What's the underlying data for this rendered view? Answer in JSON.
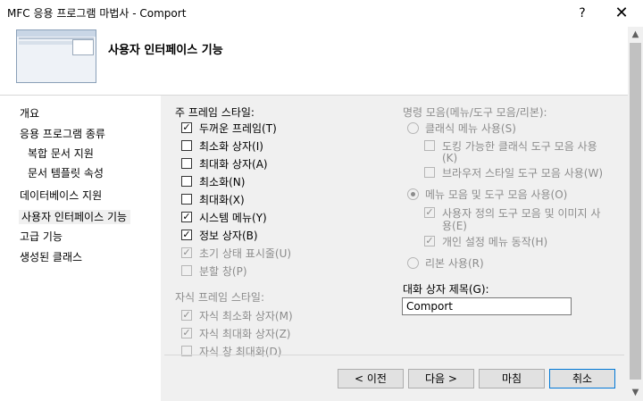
{
  "window": {
    "title": "MFC 응용 프로그램 마법사 - Comport",
    "help_glyph": "?",
    "close_glyph": "✕"
  },
  "header": {
    "title": "사용자 인터페이스 기능"
  },
  "nav": {
    "items": [
      {
        "label": "개요"
      },
      {
        "label": "응용 프로그램 종류"
      },
      {
        "label": "복합 문서 지원"
      },
      {
        "label": "문서 템플릿 속성"
      },
      {
        "label": "데이터베이스 지원"
      },
      {
        "label": "사용자 인터페이스 기능"
      },
      {
        "label": "고급 기능"
      },
      {
        "label": "생성된 클래스"
      }
    ]
  },
  "main_frame": {
    "label": "주 프레임 스타일:",
    "options": [
      {
        "label": "두꺼운 프레임(T)",
        "checked": true,
        "enabled": true
      },
      {
        "label": "최소화 상자(I)",
        "checked": false,
        "enabled": true
      },
      {
        "label": "최대화 상자(A)",
        "checked": false,
        "enabled": true
      },
      {
        "label": "최소화(N)",
        "checked": false,
        "enabled": true
      },
      {
        "label": "최대화(X)",
        "checked": false,
        "enabled": true
      },
      {
        "label": "시스템 메뉴(Y)",
        "checked": true,
        "enabled": true
      },
      {
        "label": "정보 상자(B)",
        "checked": true,
        "enabled": true
      },
      {
        "label": "초기 상태 표시줄(U)",
        "checked": true,
        "enabled": false
      },
      {
        "label": "분할 창(P)",
        "checked": false,
        "enabled": false
      }
    ]
  },
  "child_frame": {
    "label": "자식 프레임 스타일:",
    "options": [
      {
        "label": "자식 최소화 상자(M)",
        "checked": true
      },
      {
        "label": "자식 최대화 상자(Z)",
        "checked": true
      },
      {
        "label": "자식 창 최대화(D)",
        "checked": false
      }
    ]
  },
  "command_bar": {
    "label": "명령 모음(메뉴/도구 모음/리본):",
    "classic": "클래식 메뉴 사용(S)",
    "classic_dock_line1": "도킹 가능한 클래식 도구 모음 사용",
    "classic_dock_line2": "(K)",
    "classic_browser": "브라우저 스타일 도구 모음 사용(W)",
    "menubar": "메뉴 모음 및 도구 모음 사용(O)",
    "user_defined_line1": "사용자 정의 도구 모음 및 이미지 사",
    "user_defined_line2": "용(E)",
    "personal_menu": "개인 설정 메뉴 동작(H)",
    "ribbon": "리본 사용(R)"
  },
  "dialog_title": {
    "label": "대화 상자 제목(G):",
    "value": "Comport"
  },
  "buttons": {
    "prev": "< 이전",
    "next": "다음 >",
    "finish": "마침",
    "cancel": "취소"
  },
  "check_glyph": "✓",
  "scroll": {
    "up": "▲",
    "down": "▼"
  }
}
